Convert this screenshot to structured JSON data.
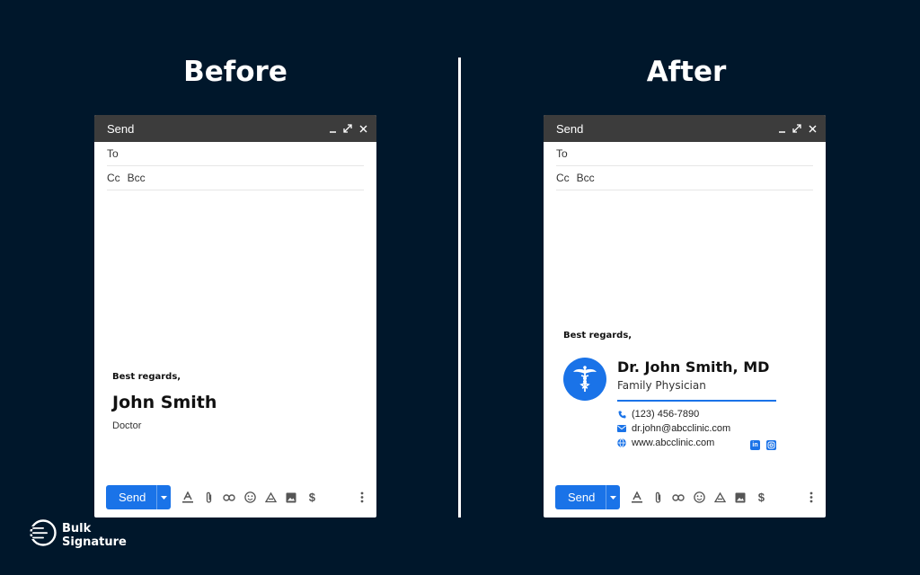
{
  "before": {
    "heading": "Before",
    "window_title": "Send",
    "to_label": "To",
    "cc_label": "Cc",
    "bcc_label": "Bcc",
    "signature": {
      "closing": "Best regards,",
      "name": "John Smith",
      "role": "Doctor"
    },
    "send_label": "Send"
  },
  "after": {
    "heading": "After",
    "window_title": "Send",
    "to_label": "To",
    "cc_label": "Cc",
    "bcc_label": "Bcc",
    "signature": {
      "closing": "Best regards,",
      "name": "Dr. John Smith, MD",
      "title": "Family Physician",
      "phone": "(123) 456-7890",
      "email": "dr.john@abcclinic.com",
      "website": "www.abcclinic.com",
      "logo_icon": "caduceus-icon",
      "socials": [
        "linkedin-icon",
        "instagram-icon"
      ]
    },
    "send_label": "Send"
  },
  "toolbar_icons": [
    "text-format-icon",
    "attach-icon",
    "link-icon",
    "emoji-icon",
    "drive-icon",
    "image-icon",
    "dollar-icon",
    "more-vert-icon"
  ],
  "brand": {
    "line1": "Bulk",
    "line2": "Signature"
  },
  "colors": {
    "background": "#00172b",
    "accent": "#1a73e8",
    "header": "#3c3c3c"
  }
}
